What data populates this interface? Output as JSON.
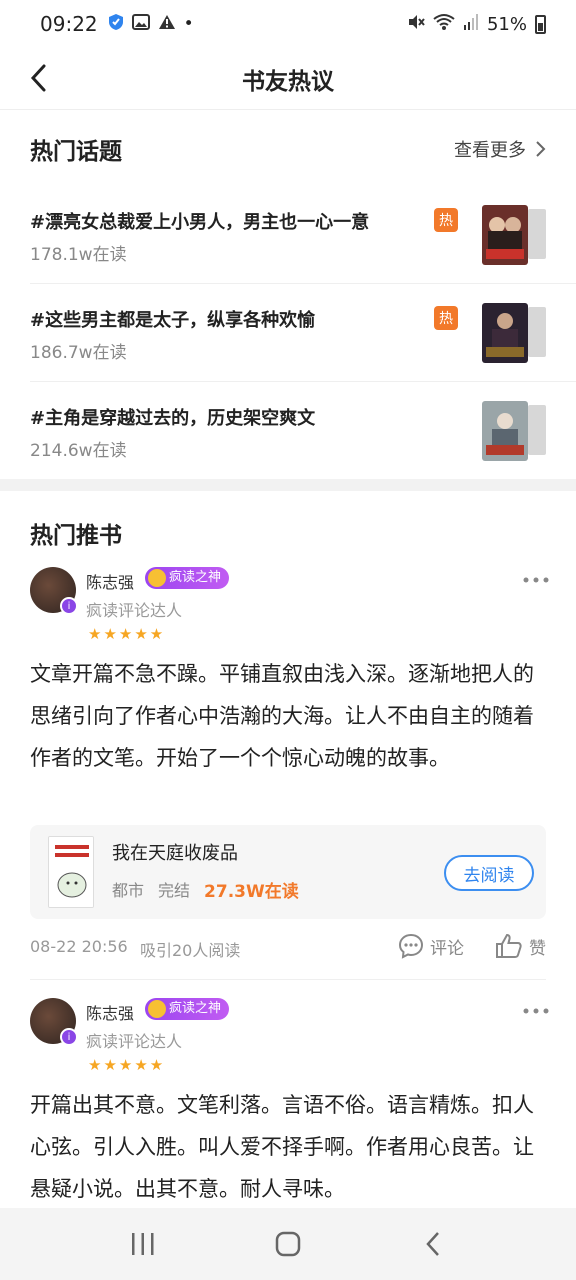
{
  "status_bar": {
    "time": "09:22",
    "battery": "51%"
  },
  "header": {
    "title": "书友热议"
  },
  "hot_topics": {
    "title": "热门话题",
    "more_label": "查看更多",
    "items": [
      {
        "title": "#漂亮女总裁爱上小男人，男主也一心一意",
        "reads": "178.1w在读",
        "badge": "热"
      },
      {
        "title": "#这些男主都是太子，纵享各种欢愉",
        "reads": "186.7w在读",
        "badge": "热"
      },
      {
        "title": "#主角是穿越过去的，历史架空爽文",
        "reads": "214.6w在读",
        "badge": ""
      }
    ]
  },
  "hot_books": {
    "title": "热门推书",
    "reviews": [
      {
        "name": "陈志强",
        "level": "疯读之神",
        "subtitle": "疯读评论达人",
        "rating": 5,
        "stars": "★★★★★",
        "text": "文章开篇不急不躁。平铺直叙由浅入深。逐渐地把人的思绪引向了作者心中浩瀚的大海。让人不由自主的随着作者的文笔。开始了一个个惊心动魄的故事。",
        "book": {
          "title": "我在天庭收废品",
          "genre": "都市",
          "status": "完结",
          "reads": "27.3W在读",
          "button": "去阅读"
        },
        "date": "08-22 20:56",
        "attracted": "吸引20人阅读",
        "comment_label": "评论",
        "like_label": "赞"
      },
      {
        "name": "陈志强",
        "level": "疯读之神",
        "subtitle": "疯读评论达人",
        "rating": 5,
        "stars": "★★★★★",
        "text": "开篇出其不意。文笔利落。言语不俗。语言精炼。扣人心弦。引人入胜。叫人爱不择手啊。作者用心良苦。让悬疑小说。出其不意。耐人寻味。"
      }
    ]
  },
  "colors": {
    "hot_orange": "#f2792a",
    "level_purple": "#9b45f0",
    "read_blue": "#2f84ee",
    "star_gold": "#f6a623"
  }
}
